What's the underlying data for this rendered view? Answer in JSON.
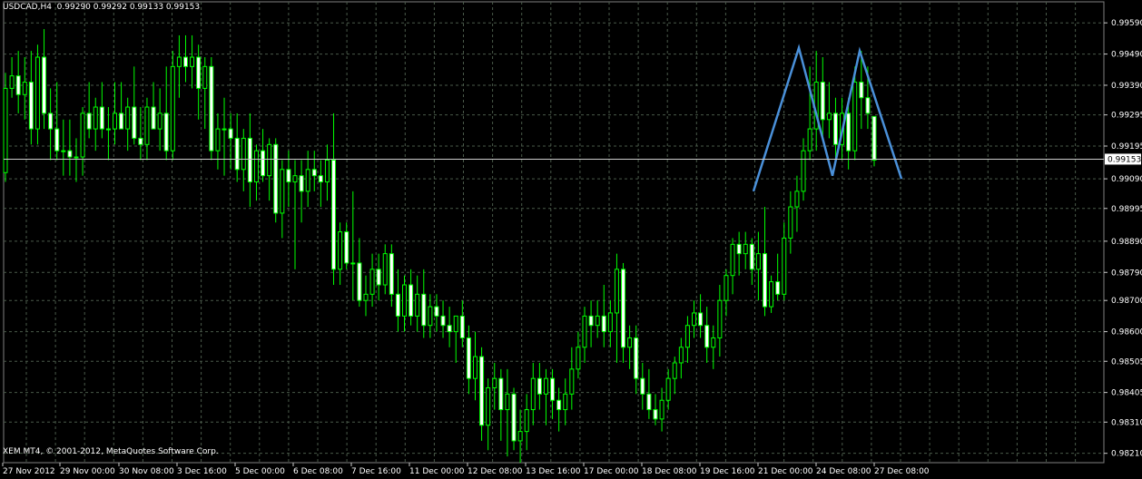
{
  "window": {
    "symbol_info": "USDCAD,H4  0.99290 0.99292 0.99133 0.99153",
    "copyright": "XEM MT4, © 2001-2012, MetaQuotes Software Corp."
  },
  "chart_data": {
    "type": "candlestick",
    "symbol": "USDCAD",
    "timeframe": "H4",
    "ohlc_header": {
      "open": 0.9929,
      "high": 0.99292,
      "low": 0.99133,
      "close": 0.99153
    },
    "current_price": 0.99153,
    "current_price_label": "0.99153",
    "ylim": [
      0.9818,
      0.9964
    ],
    "y_ticks": [
      "0.99590",
      "0.99490",
      "0.99390",
      "0.99295",
      "0.99195",
      "0.99090",
      "0.98995",
      "0.98890",
      "0.98790",
      "0.98700",
      "0.98600",
      "0.98505",
      "0.98405",
      "0.98310",
      "0.98210"
    ],
    "x_ticks": [
      "27 Nov 2012",
      "29 Nov 00:00",
      "30 Nov 08:00",
      "3 Dec 16:00",
      "5 Dec 00:00",
      "6 Dec 08:00",
      "7 Dec 16:00",
      "11 Dec 00:00",
      "12 Dec 08:00",
      "13 Dec 16:00",
      "17 Dec 00:00",
      "18 Dec 08:00",
      "19 Dec 16:00",
      "21 Dec 00:00",
      "24 Dec 08:00",
      "27 Dec 08:00"
    ],
    "grid": true,
    "colors": {
      "background": "#000000",
      "grid": "#4a5a4a",
      "bull": "#00ff00",
      "bear": "#00dd00",
      "body_fill": "#ffffff",
      "pattern_line": "#4a90d9",
      "price_line": "#cccccc"
    },
    "candles": [
      {
        "o": 0.9911,
        "h": 0.9943,
        "l": 0.9908,
        "c": 0.9938
      },
      {
        "o": 0.9938,
        "h": 0.9948,
        "l": 0.9935,
        "c": 0.9942
      },
      {
        "o": 0.9942,
        "h": 0.995,
        "l": 0.993,
        "c": 0.9936
      },
      {
        "o": 0.9936,
        "h": 0.9948,
        "l": 0.9928,
        "c": 0.994
      },
      {
        "o": 0.994,
        "h": 0.995,
        "l": 0.992,
        "c": 0.9925
      },
      {
        "o": 0.9925,
        "h": 0.9952,
        "l": 0.992,
        "c": 0.9948
      },
      {
        "o": 0.9948,
        "h": 0.9957,
        "l": 0.9925,
        "c": 0.993
      },
      {
        "o": 0.993,
        "h": 0.9938,
        "l": 0.9915,
        "c": 0.9925
      },
      {
        "o": 0.9925,
        "h": 0.994,
        "l": 0.9915,
        "c": 0.9918
      },
      {
        "o": 0.9918,
        "h": 0.9928,
        "l": 0.991,
        "c": 0.9918
      },
      {
        "o": 0.9918,
        "h": 0.9928,
        "l": 0.991,
        "c": 0.9916
      },
      {
        "o": 0.9916,
        "h": 0.9922,
        "l": 0.9908,
        "c": 0.9916
      },
      {
        "o": 0.9916,
        "h": 0.9932,
        "l": 0.991,
        "c": 0.993
      },
      {
        "o": 0.993,
        "h": 0.994,
        "l": 0.9922,
        "c": 0.9925
      },
      {
        "o": 0.9925,
        "h": 0.9935,
        "l": 0.9918,
        "c": 0.9932
      },
      {
        "o": 0.9932,
        "h": 0.994,
        "l": 0.9922,
        "c": 0.9925
      },
      {
        "o": 0.9925,
        "h": 0.9932,
        "l": 0.9915,
        "c": 0.9925
      },
      {
        "o": 0.9925,
        "h": 0.994,
        "l": 0.992,
        "c": 0.993
      },
      {
        "o": 0.993,
        "h": 0.994,
        "l": 0.9925,
        "c": 0.9925
      },
      {
        "o": 0.9925,
        "h": 0.9935,
        "l": 0.9918,
        "c": 0.9932
      },
      {
        "o": 0.9932,
        "h": 0.9945,
        "l": 0.992,
        "c": 0.9922
      },
      {
        "o": 0.9922,
        "h": 0.9932,
        "l": 0.9915,
        "c": 0.992
      },
      {
        "o": 0.992,
        "h": 0.9935,
        "l": 0.9915,
        "c": 0.9932
      },
      {
        "o": 0.9932,
        "h": 0.994,
        "l": 0.9925,
        "c": 0.9925
      },
      {
        "o": 0.9925,
        "h": 0.9938,
        "l": 0.9918,
        "c": 0.993
      },
      {
        "o": 0.993,
        "h": 0.9945,
        "l": 0.9915,
        "c": 0.9918
      },
      {
        "o": 0.9918,
        "h": 0.995,
        "l": 0.9915,
        "c": 0.9945
      },
      {
        "o": 0.9945,
        "h": 0.9955,
        "l": 0.9935,
        "c": 0.9948
      },
      {
        "o": 0.9948,
        "h": 0.9955,
        "l": 0.994,
        "c": 0.9945
      },
      {
        "o": 0.9945,
        "h": 0.9955,
        "l": 0.9938,
        "c": 0.9948
      },
      {
        "o": 0.9948,
        "h": 0.9952,
        "l": 0.9928,
        "c": 0.9938
      },
      {
        "o": 0.9938,
        "h": 0.9948,
        "l": 0.9925,
        "c": 0.9945
      },
      {
        "o": 0.9945,
        "h": 0.9948,
        "l": 0.9915,
        "c": 0.9918
      },
      {
        "o": 0.9918,
        "h": 0.993,
        "l": 0.9912,
        "c": 0.9925
      },
      {
        "o": 0.9925,
        "h": 0.9935,
        "l": 0.991,
        "c": 0.9925
      },
      {
        "o": 0.9925,
        "h": 0.993,
        "l": 0.9912,
        "c": 0.9922
      },
      {
        "o": 0.9922,
        "h": 0.993,
        "l": 0.9908,
        "c": 0.9912
      },
      {
        "o": 0.9912,
        "h": 0.9925,
        "l": 0.9905,
        "c": 0.9922
      },
      {
        "o": 0.9922,
        "h": 0.993,
        "l": 0.99,
        "c": 0.9908
      },
      {
        "o": 0.9908,
        "h": 0.992,
        "l": 0.9902,
        "c": 0.9918
      },
      {
        "o": 0.9918,
        "h": 0.9925,
        "l": 0.9908,
        "c": 0.991
      },
      {
        "o": 0.991,
        "h": 0.9922,
        "l": 0.9902,
        "c": 0.992
      },
      {
        "o": 0.992,
        "h": 0.9922,
        "l": 0.9895,
        "c": 0.9898
      },
      {
        "o": 0.9898,
        "h": 0.9915,
        "l": 0.989,
        "c": 0.9912
      },
      {
        "o": 0.9912,
        "h": 0.9918,
        "l": 0.99,
        "c": 0.9908
      },
      {
        "o": 0.9908,
        "h": 0.9915,
        "l": 0.988,
        "c": 0.991
      },
      {
        "o": 0.991,
        "h": 0.9915,
        "l": 0.9895,
        "c": 0.9905
      },
      {
        "o": 0.9905,
        "h": 0.9918,
        "l": 0.99,
        "c": 0.9912
      },
      {
        "o": 0.9912,
        "h": 0.9918,
        "l": 0.9905,
        "c": 0.991
      },
      {
        "o": 0.991,
        "h": 0.9915,
        "l": 0.99,
        "c": 0.9908
      },
      {
        "o": 0.9908,
        "h": 0.992,
        "l": 0.9902,
        "c": 0.9915
      },
      {
        "o": 0.9915,
        "h": 0.993,
        "l": 0.9875,
        "c": 0.988
      },
      {
        "o": 0.988,
        "h": 0.9895,
        "l": 0.9875,
        "c": 0.9892
      },
      {
        "o": 0.9892,
        "h": 0.9895,
        "l": 0.988,
        "c": 0.9882
      },
      {
        "o": 0.9882,
        "h": 0.9905,
        "l": 0.987,
        "c": 0.9882
      },
      {
        "o": 0.9882,
        "h": 0.989,
        "l": 0.9868,
        "c": 0.987
      },
      {
        "o": 0.987,
        "h": 0.9878,
        "l": 0.9865,
        "c": 0.9872
      },
      {
        "o": 0.9872,
        "h": 0.9885,
        "l": 0.9868,
        "c": 0.988
      },
      {
        "o": 0.988,
        "h": 0.9885,
        "l": 0.987,
        "c": 0.9875
      },
      {
        "o": 0.9875,
        "h": 0.9888,
        "l": 0.9872,
        "c": 0.9885
      },
      {
        "o": 0.9885,
        "h": 0.9888,
        "l": 0.9868,
        "c": 0.9872
      },
      {
        "o": 0.9872,
        "h": 0.988,
        "l": 0.986,
        "c": 0.9865
      },
      {
        "o": 0.9865,
        "h": 0.9878,
        "l": 0.986,
        "c": 0.9875
      },
      {
        "o": 0.9875,
        "h": 0.988,
        "l": 0.9862,
        "c": 0.9865
      },
      {
        "o": 0.9865,
        "h": 0.9878,
        "l": 0.986,
        "c": 0.9872
      },
      {
        "o": 0.9872,
        "h": 0.988,
        "l": 0.9858,
        "c": 0.9862
      },
      {
        "o": 0.9862,
        "h": 0.9872,
        "l": 0.9858,
        "c": 0.9868
      },
      {
        "o": 0.9868,
        "h": 0.9872,
        "l": 0.986,
        "c": 0.9865
      },
      {
        "o": 0.9865,
        "h": 0.987,
        "l": 0.9858,
        "c": 0.9862
      },
      {
        "o": 0.9862,
        "h": 0.9868,
        "l": 0.9855,
        "c": 0.986
      },
      {
        "o": 0.986,
        "h": 0.9865,
        "l": 0.985,
        "c": 0.9865
      },
      {
        "o": 0.9865,
        "h": 0.987,
        "l": 0.9855,
        "c": 0.9858
      },
      {
        "o": 0.9858,
        "h": 0.9862,
        "l": 0.984,
        "c": 0.9845
      },
      {
        "o": 0.9845,
        "h": 0.986,
        "l": 0.9838,
        "c": 0.9852
      },
      {
        "o": 0.9852,
        "h": 0.9855,
        "l": 0.9825,
        "c": 0.983
      },
      {
        "o": 0.983,
        "h": 0.9845,
        "l": 0.9822,
        "c": 0.9842
      },
      {
        "o": 0.9842,
        "h": 0.985,
        "l": 0.9835,
        "c": 0.9845
      },
      {
        "o": 0.9845,
        "h": 0.9848,
        "l": 0.9825,
        "c": 0.9835
      },
      {
        "o": 0.9835,
        "h": 0.9848,
        "l": 0.982,
        "c": 0.984
      },
      {
        "o": 0.984,
        "h": 0.9842,
        "l": 0.9822,
        "c": 0.9825
      },
      {
        "o": 0.9825,
        "h": 0.9835,
        "l": 0.9818,
        "c": 0.9828
      },
      {
        "o": 0.9828,
        "h": 0.984,
        "l": 0.9822,
        "c": 0.9835
      },
      {
        "o": 0.9835,
        "h": 0.985,
        "l": 0.983,
        "c": 0.9845
      },
      {
        "o": 0.9845,
        "h": 0.985,
        "l": 0.9835,
        "c": 0.984
      },
      {
        "o": 0.984,
        "h": 0.9848,
        "l": 0.983,
        "c": 0.9845
      },
      {
        "o": 0.9845,
        "h": 0.9848,
        "l": 0.9832,
        "c": 0.9838
      },
      {
        "o": 0.9838,
        "h": 0.9842,
        "l": 0.9828,
        "c": 0.9835
      },
      {
        "o": 0.9835,
        "h": 0.9845,
        "l": 0.983,
        "c": 0.984
      },
      {
        "o": 0.984,
        "h": 0.9855,
        "l": 0.9835,
        "c": 0.9848
      },
      {
        "o": 0.9848,
        "h": 0.986,
        "l": 0.9845,
        "c": 0.9855
      },
      {
        "o": 0.9855,
        "h": 0.9868,
        "l": 0.985,
        "c": 0.9865
      },
      {
        "o": 0.9865,
        "h": 0.987,
        "l": 0.9855,
        "c": 0.9862
      },
      {
        "o": 0.9862,
        "h": 0.987,
        "l": 0.9858,
        "c": 0.9865
      },
      {
        "o": 0.9865,
        "h": 0.9875,
        "l": 0.9855,
        "c": 0.986
      },
      {
        "o": 0.986,
        "h": 0.987,
        "l": 0.9855,
        "c": 0.9866
      },
      {
        "o": 0.9866,
        "h": 0.9885,
        "l": 0.985,
        "c": 0.988
      },
      {
        "o": 0.988,
        "h": 0.9882,
        "l": 0.985,
        "c": 0.9855
      },
      {
        "o": 0.9855,
        "h": 0.9862,
        "l": 0.9848,
        "c": 0.9858
      },
      {
        "o": 0.9858,
        "h": 0.9862,
        "l": 0.984,
        "c": 0.9845
      },
      {
        "o": 0.9845,
        "h": 0.985,
        "l": 0.9835,
        "c": 0.984
      },
      {
        "o": 0.984,
        "h": 0.9848,
        "l": 0.9832,
        "c": 0.9835
      },
      {
        "o": 0.9835,
        "h": 0.984,
        "l": 0.983,
        "c": 0.9832
      },
      {
        "o": 0.9832,
        "h": 0.9842,
        "l": 0.9828,
        "c": 0.9838
      },
      {
        "o": 0.9838,
        "h": 0.9848,
        "l": 0.9835,
        "c": 0.9845
      },
      {
        "o": 0.9845,
        "h": 0.9852,
        "l": 0.984,
        "c": 0.985
      },
      {
        "o": 0.985,
        "h": 0.9858,
        "l": 0.9845,
        "c": 0.9855
      },
      {
        "o": 0.9855,
        "h": 0.9865,
        "l": 0.985,
        "c": 0.9862
      },
      {
        "o": 0.9862,
        "h": 0.987,
        "l": 0.9858,
        "c": 0.9866
      },
      {
        "o": 0.9866,
        "h": 0.9872,
        "l": 0.9858,
        "c": 0.9862
      },
      {
        "o": 0.9862,
        "h": 0.9868,
        "l": 0.985,
        "c": 0.9855
      },
      {
        "o": 0.9855,
        "h": 0.9862,
        "l": 0.9848,
        "c": 0.9858
      },
      {
        "o": 0.9858,
        "h": 0.9875,
        "l": 0.9852,
        "c": 0.987
      },
      {
        "o": 0.987,
        "h": 0.988,
        "l": 0.9865,
        "c": 0.9878
      },
      {
        "o": 0.9878,
        "h": 0.989,
        "l": 0.9872,
        "c": 0.9888
      },
      {
        "o": 0.9888,
        "h": 0.9892,
        "l": 0.9878,
        "c": 0.9885
      },
      {
        "o": 0.9885,
        "h": 0.9892,
        "l": 0.988,
        "c": 0.9888
      },
      {
        "o": 0.9888,
        "h": 0.989,
        "l": 0.9875,
        "c": 0.988
      },
      {
        "o": 0.988,
        "h": 0.9892,
        "l": 0.987,
        "c": 0.9885
      },
      {
        "o": 0.9885,
        "h": 0.99,
        "l": 0.9865,
        "c": 0.9868
      },
      {
        "o": 0.9868,
        "h": 0.9878,
        "l": 0.9866,
        "c": 0.9876
      },
      {
        "o": 0.9876,
        "h": 0.9885,
        "l": 0.987,
        "c": 0.9872
      },
      {
        "o": 0.9872,
        "h": 0.9895,
        "l": 0.987,
        "c": 0.989
      },
      {
        "o": 0.989,
        "h": 0.9905,
        "l": 0.9885,
        "c": 0.99
      },
      {
        "o": 0.99,
        "h": 0.991,
        "l": 0.9892,
        "c": 0.9905
      },
      {
        "o": 0.9905,
        "h": 0.9922,
        "l": 0.9902,
        "c": 0.9918
      },
      {
        "o": 0.9918,
        "h": 0.9945,
        "l": 0.9915,
        "c": 0.9925
      },
      {
        "o": 0.9925,
        "h": 0.995,
        "l": 0.9918,
        "c": 0.994
      },
      {
        "o": 0.994,
        "h": 0.9948,
        "l": 0.9922,
        "c": 0.9928
      },
      {
        "o": 0.9928,
        "h": 0.994,
        "l": 0.9922,
        "c": 0.993
      },
      {
        "o": 0.993,
        "h": 0.9935,
        "l": 0.9915,
        "c": 0.992
      },
      {
        "o": 0.992,
        "h": 0.9935,
        "l": 0.9915,
        "c": 0.993
      },
      {
        "o": 0.993,
        "h": 0.9935,
        "l": 0.9912,
        "c": 0.9918
      },
      {
        "o": 0.9918,
        "h": 0.9945,
        "l": 0.9915,
        "c": 0.994
      },
      {
        "o": 0.994,
        "h": 0.995,
        "l": 0.9925,
        "c": 0.9935
      },
      {
        "o": 0.9935,
        "h": 0.9945,
        "l": 0.9925,
        "c": 0.993
      },
      {
        "o": 0.9929,
        "h": 0.9929,
        "l": 0.9913,
        "c": 0.9915
      }
    ],
    "pattern_line": {
      "name": "double-top",
      "points": [
        [
          0.99048,
          0.9903
        ],
        [
          0.99048,
          0.99515
        ]
      ]
    }
  }
}
